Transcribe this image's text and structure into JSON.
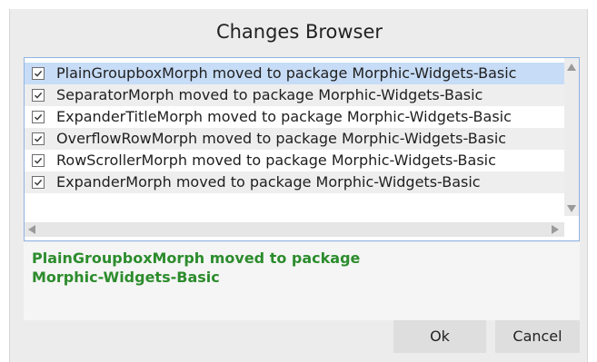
{
  "window": {
    "title": "Changes Browser"
  },
  "changes": [
    {
      "label": "PlainGroupboxMorph moved to package Morphic-Widgets-Basic",
      "checked": true,
      "selected": true
    },
    {
      "label": "SeparatorMorph moved to package Morphic-Widgets-Basic",
      "checked": true,
      "selected": false
    },
    {
      "label": "ExpanderTitleMorph moved to package Morphic-Widgets-Basic",
      "checked": true,
      "selected": false
    },
    {
      "label": "OverflowRowMorph moved to package Morphic-Widgets-Basic",
      "checked": true,
      "selected": false
    },
    {
      "label": "RowScrollerMorph moved to package Morphic-Widgets-Basic",
      "checked": true,
      "selected": false
    },
    {
      "label": "ExpanderMorph moved to package Morphic-Widgets-Basic",
      "checked": true,
      "selected": false
    }
  ],
  "detail": {
    "line1": "PlainGroupboxMorph moved to package",
    "line2": "Morphic-Widgets-Basic"
  },
  "buttons": {
    "ok": "Ok",
    "cancel": "Cancel"
  },
  "icons": {
    "scroll_up": "scroll-up-arrow-icon",
    "scroll_down": "scroll-down-arrow-icon",
    "scroll_left": "scroll-left-arrow-icon",
    "scroll_right": "scroll-right-arrow-icon",
    "checkbox": "checkmark-icon"
  },
  "colors": {
    "selection": "#c7dcf6",
    "detail_text": "#2c8c2c"
  }
}
